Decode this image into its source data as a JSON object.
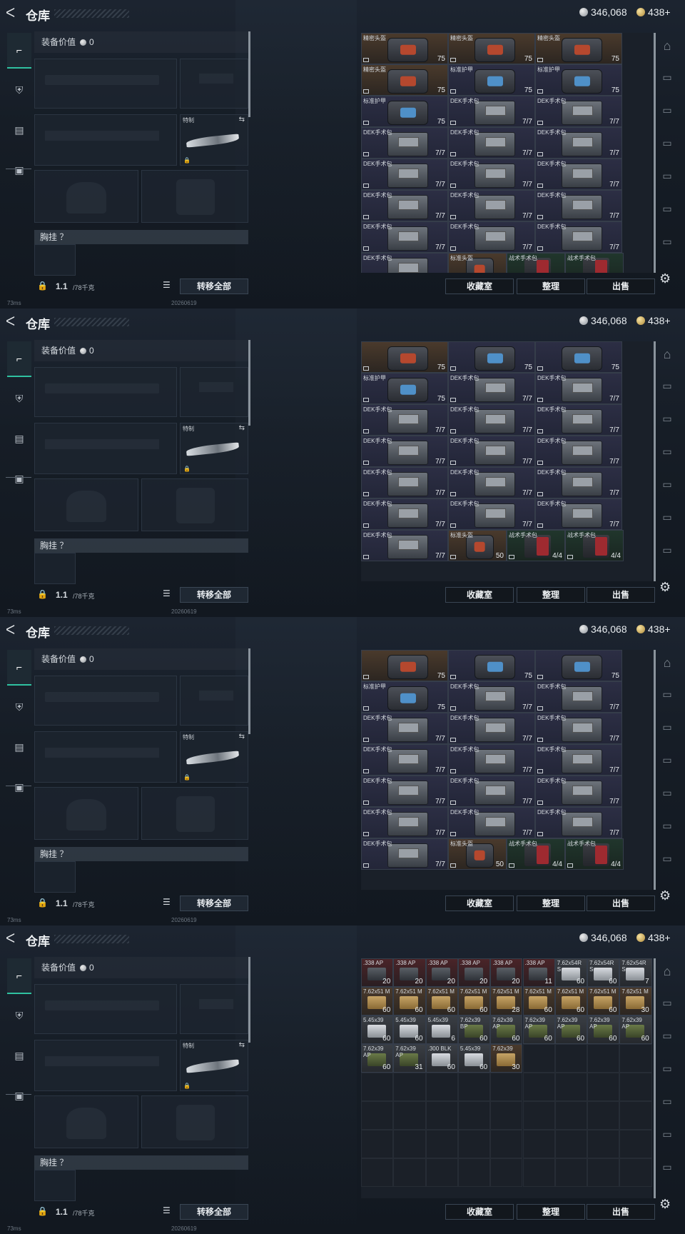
{
  "header": {
    "back_icon": "back-arrow-icon",
    "title": "仓库",
    "silver": "346,068",
    "gold": "438+"
  },
  "left": {
    "tabs": [
      "weapon-icon",
      "helmet-icon",
      "clipboard-icon",
      "briefcase-icon"
    ],
    "equip_value_label": "装备价值",
    "equip_value": "0",
    "melee_label": "特制",
    "chest_label": "胸挂 ？",
    "weight_value": "1.1",
    "weight_max": "/78千克",
    "transfer_all": "转移全部"
  },
  "buttons": {
    "collection": "收藏室",
    "sort": "整理",
    "sell": "出售"
  },
  "status": {
    "ping": "73ms",
    "stamp": "20260619"
  },
  "frames": [
    {
      "rows": [
        [
          {
            "n": "精密头盔",
            "c": "75",
            "k": "helmet"
          },
          {
            "n": "精密头盔",
            "c": "75",
            "k": "helmet"
          },
          {
            "n": "精密头盔",
            "c": "75",
            "k": "helmet"
          }
        ],
        [
          {
            "n": "精密头盔",
            "c": "75",
            "k": "helmet"
          },
          {
            "n": "标准护甲",
            "c": "75",
            "k": "armor"
          },
          {
            "n": "标准护甲",
            "c": "75",
            "k": "armor"
          }
        ],
        [
          {
            "n": "标准护甲",
            "c": "75",
            "k": "armor"
          },
          {
            "n": "DEK手术包",
            "c": "7/7",
            "k": "kit"
          },
          {
            "n": "DEK手术包",
            "c": "7/7",
            "k": "kit"
          }
        ],
        [
          {
            "n": "DEK手术包",
            "c": "7/7",
            "k": "kit"
          },
          {
            "n": "DEK手术包",
            "c": "7/7",
            "k": "kit"
          },
          {
            "n": "DEK手术包",
            "c": "7/7",
            "k": "kit"
          }
        ],
        [
          {
            "n": "DEK手术包",
            "c": "7/7",
            "k": "kit"
          },
          {
            "n": "DEK手术包",
            "c": "7/7",
            "k": "kit"
          },
          {
            "n": "DEK手术包",
            "c": "7/7",
            "k": "kit"
          }
        ],
        [
          {
            "n": "DEK手术包",
            "c": "7/7",
            "k": "kit"
          },
          {
            "n": "DEK手术包",
            "c": "7/7",
            "k": "kit"
          },
          {
            "n": "DEK手术包",
            "c": "7/7",
            "k": "kit"
          }
        ],
        [
          {
            "n": "DEK手术包",
            "c": "7/7",
            "k": "kit"
          },
          {
            "n": "DEK手术包",
            "c": "7/7",
            "k": "kit"
          },
          {
            "n": "DEK手术包",
            "c": "7/7",
            "k": "kit"
          }
        ],
        [
          {
            "n": "DEK手术包",
            "c": "",
            "k": "kit"
          },
          {
            "n": "标准头盔",
            "c": "",
            "k": "helmet"
          },
          {
            "n": "战术手术包",
            "c": "",
            "k": "med"
          },
          {
            "n": "战术手术包",
            "c": "",
            "k": "med"
          }
        ]
      ]
    },
    {
      "rows": [
        [
          {
            "n": "",
            "c": "75",
            "k": "helmet"
          },
          {
            "n": "",
            "c": "75",
            "k": "armor"
          },
          {
            "n": "",
            "c": "75",
            "k": "armor"
          }
        ],
        [
          {
            "n": "标准护甲",
            "c": "75",
            "k": "armor"
          },
          {
            "n": "DEK手术包",
            "c": "7/7",
            "k": "kit"
          },
          {
            "n": "DEK手术包",
            "c": "7/7",
            "k": "kit"
          }
        ],
        [
          {
            "n": "DEK手术包",
            "c": "7/7",
            "k": "kit"
          },
          {
            "n": "DEK手术包",
            "c": "7/7",
            "k": "kit"
          },
          {
            "n": "DEK手术包",
            "c": "7/7",
            "k": "kit"
          }
        ],
        [
          {
            "n": "DEK手术包",
            "c": "7/7",
            "k": "kit"
          },
          {
            "n": "DEK手术包",
            "c": "7/7",
            "k": "kit"
          },
          {
            "n": "DEK手术包",
            "c": "7/7",
            "k": "kit"
          }
        ],
        [
          {
            "n": "DEK手术包",
            "c": "7/7",
            "k": "kit"
          },
          {
            "n": "DEK手术包",
            "c": "7/7",
            "k": "kit"
          },
          {
            "n": "DEK手术包",
            "c": "7/7",
            "k": "kit"
          }
        ],
        [
          {
            "n": "DEK手术包",
            "c": "7/7",
            "k": "kit"
          },
          {
            "n": "DEK手术包",
            "c": "7/7",
            "k": "kit"
          },
          {
            "n": "DEK手术包",
            "c": "7/7",
            "k": "kit"
          }
        ],
        [
          {
            "n": "DEK手术包",
            "c": "7/7",
            "k": "kit"
          },
          {
            "n": "标准头盔",
            "c": "50",
            "k": "helmet"
          },
          {
            "n": "战术手术包",
            "c": "4/4",
            "k": "med"
          },
          {
            "n": "战术手术包",
            "c": "4/4",
            "k": "med"
          }
        ]
      ]
    },
    {
      "rows": [
        [
          {
            "n": "",
            "c": "75",
            "k": "helmet"
          },
          {
            "n": "",
            "c": "75",
            "k": "armor"
          },
          {
            "n": "",
            "c": "75",
            "k": "armor"
          }
        ],
        [
          {
            "n": "标准护甲",
            "c": "75",
            "k": "armor"
          },
          {
            "n": "DEK手术包",
            "c": "7/7",
            "k": "kit"
          },
          {
            "n": "DEK手术包",
            "c": "7/7",
            "k": "kit"
          }
        ],
        [
          {
            "n": "DEK手术包",
            "c": "7/7",
            "k": "kit"
          },
          {
            "n": "DEK手术包",
            "c": "7/7",
            "k": "kit"
          },
          {
            "n": "DEK手术包",
            "c": "7/7",
            "k": "kit"
          }
        ],
        [
          {
            "n": "DEK手术包",
            "c": "7/7",
            "k": "kit"
          },
          {
            "n": "DEK手术包",
            "c": "7/7",
            "k": "kit"
          },
          {
            "n": "DEK手术包",
            "c": "7/7",
            "k": "kit"
          }
        ],
        [
          {
            "n": "DEK手术包",
            "c": "7/7",
            "k": "kit"
          },
          {
            "n": "DEK手术包",
            "c": "7/7",
            "k": "kit"
          },
          {
            "n": "DEK手术包",
            "c": "7/7",
            "k": "kit"
          }
        ],
        [
          {
            "n": "DEK手术包",
            "c": "7/7",
            "k": "kit"
          },
          {
            "n": "DEK手术包",
            "c": "7/7",
            "k": "kit"
          },
          {
            "n": "DEK手术包",
            "c": "7/7",
            "k": "kit"
          }
        ],
        [
          {
            "n": "DEK手术包",
            "c": "7/7",
            "k": "kit"
          },
          {
            "n": "标准头盔",
            "c": "50",
            "k": "helmet"
          },
          {
            "n": "战术手术包",
            "c": "4/4",
            "k": "med"
          },
          {
            "n": "战术手术包",
            "c": "4/4",
            "k": "med"
          }
        ]
      ]
    },
    {
      "ammo_rows": [
        [
          {
            "n": ".338 AP",
            "c": "20",
            "t": "rd"
          },
          {
            "n": ".338 AP",
            "c": "20",
            "t": "rd"
          },
          {
            "n": ".338 AP",
            "c": "20",
            "t": "rd"
          },
          {
            "n": ".338 AP",
            "c": "20",
            "t": "rd"
          },
          {
            "n": ".338 AP",
            "c": "20",
            "t": "rd"
          },
          {
            "n": ".338 AP",
            "c": "11",
            "t": "rd"
          },
          {
            "n": "7.62x54R S",
            "c": "60",
            "t": "w"
          },
          {
            "n": "7.62x54R S",
            "c": "60",
            "t": "w"
          },
          {
            "n": "7.62x54R S",
            "c": "7",
            "t": "w"
          }
        ],
        [
          {
            "n": "7.62x51 M",
            "c": "60",
            "t": "y"
          },
          {
            "n": "7.62x51 M",
            "c": "60",
            "t": "y"
          },
          {
            "n": "7.62x51 M",
            "c": "60",
            "t": "y"
          },
          {
            "n": "7.62x51 M",
            "c": "60",
            "t": "y"
          },
          {
            "n": "7.62x51 M",
            "c": "28",
            "t": "y"
          },
          {
            "n": "7.62x51 M",
            "c": "60",
            "t": "y"
          },
          {
            "n": "7.62x51 M",
            "c": "60",
            "t": "y"
          },
          {
            "n": "7.62x51 M",
            "c": "60",
            "t": "y"
          },
          {
            "n": "7.62x51 M",
            "c": "30",
            "t": "y"
          }
        ],
        [
          {
            "n": "5.45x39",
            "c": "60",
            "t": "w"
          },
          {
            "n": "5.45x39",
            "c": "60",
            "t": "w"
          },
          {
            "n": "5.45x39",
            "c": "6",
            "t": "w"
          },
          {
            "n": "7.62x39 BP",
            "c": "60",
            "t": "gn"
          },
          {
            "n": "7.62x39 AP",
            "c": "60",
            "t": "gn"
          },
          {
            "n": "7.62x39 AP",
            "c": "60",
            "t": "gn"
          },
          {
            "n": "7.62x39 AP",
            "c": "60",
            "t": "gn"
          },
          {
            "n": "7.62x39 AP",
            "c": "60",
            "t": "gn"
          },
          {
            "n": "7.62x39 AP",
            "c": "60",
            "t": "gn"
          }
        ],
        [
          {
            "n": "7.62x39 AP",
            "c": "60",
            "t": "gn"
          },
          {
            "n": "7.62x39 AP",
            "c": "31",
            "t": "gn"
          },
          {
            "n": ".300 BLK",
            "c": "60",
            "t": "w"
          },
          {
            "n": "5.45x39",
            "c": "60",
            "t": "w"
          },
          {
            "n": "7.62x39",
            "c": "30",
            "t": "y"
          }
        ]
      ]
    }
  ]
}
